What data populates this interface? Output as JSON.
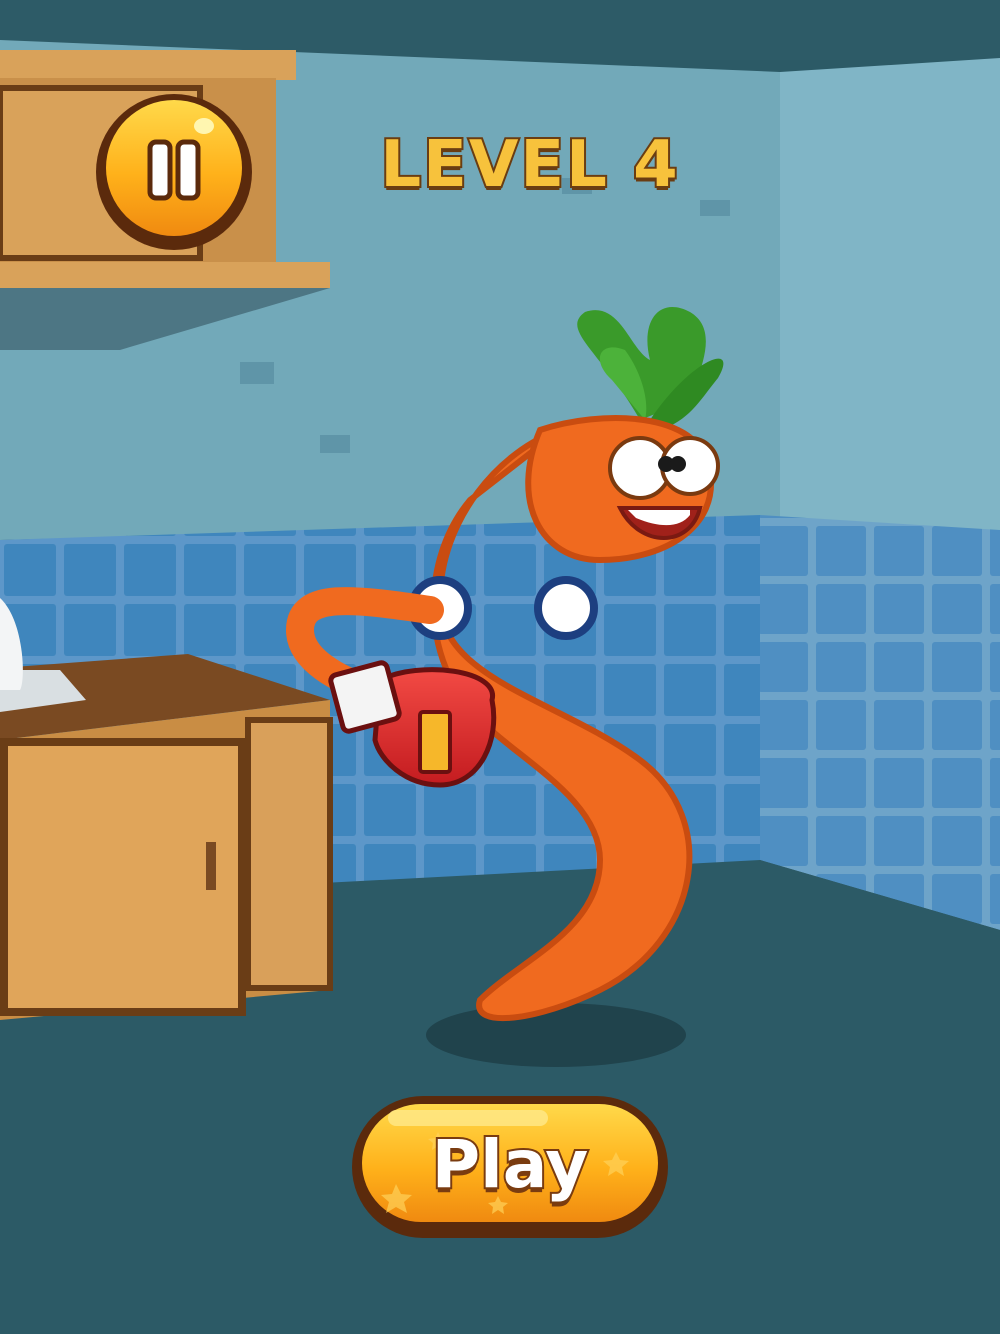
{
  "hud": {
    "level_label": "LEVEL 4",
    "pause_icon": "pause-icon"
  },
  "actions": {
    "play_label": "Play"
  },
  "scene": {
    "character": "carrot-character",
    "props": [
      "boxing-glove-icon",
      "kitchen-cabinet",
      "wall-shelf",
      "sink"
    ]
  },
  "colors": {
    "wall": "#6fa6b6",
    "tile": "#3f86bd",
    "floor": "#2c5a66",
    "carrot": "#f06a1f",
    "button_gold": "#ffb21c",
    "button_outline": "#5b2a0c",
    "title_text": "#f7c23c"
  }
}
